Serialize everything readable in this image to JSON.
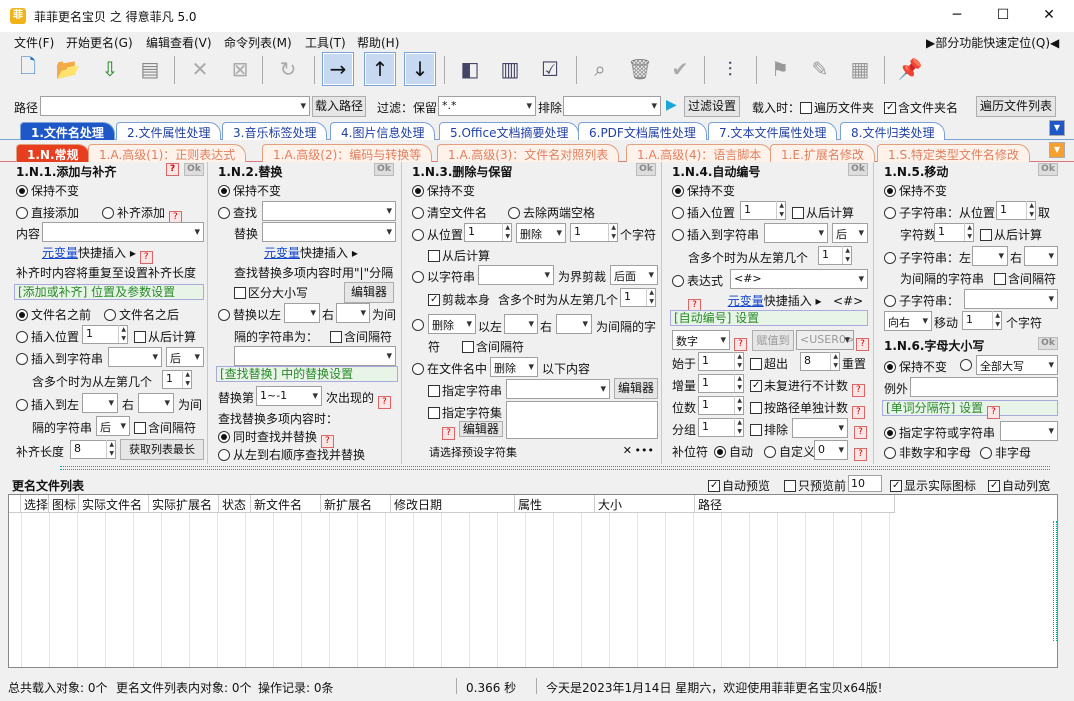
{
  "window": {
    "title": "菲菲更名宝贝 之 得意菲凡 5.0",
    "app_icon": "菲",
    "minimize": "─",
    "maximize": "☐",
    "close": "✕"
  },
  "menu": {
    "items": [
      "文件(F)",
      "开始更名(G)",
      "编辑查看(V)",
      "命令列表(M)",
      "工具(T)",
      "帮助(H)"
    ],
    "right_link": "▶部分功能快速定位(Q)◀"
  },
  "toolbar": {
    "icons": [
      "new-file-icon",
      "open-folder-icon",
      "import-icon",
      "load-list-icon",
      "delete-icon",
      "remove-icon",
      "refresh-icon",
      "move-right-icon",
      "move-up-icon",
      "move-down-icon",
      "column-left-icon",
      "column-icon",
      "checklist-icon",
      "search-icon",
      "trash-schedule-icon",
      "check-circle-icon",
      "adjust-icon",
      "flag-icon",
      "edit-doc-icon",
      "table-edit-icon",
      "pin-icon"
    ]
  },
  "pathbar": {
    "path_label": "路径",
    "path_value": "",
    "load_path": "载入路径",
    "filter_label": "过滤：保留",
    "filter_value": "*.*",
    "exclude_label": "排除",
    "exclude_value": "",
    "filter_settings": "过滤设置",
    "load_when": "载入时：",
    "traverse_files": "遍历文件夹",
    "include_folder": "含文件夹名",
    "traverse_list": "遍历文件列表"
  },
  "tabs_main": [
    "1.文件名处理",
    "2.文件属性处理",
    "3.音乐标签处理",
    "4.图片信息处理",
    "5.Office文档摘要处理",
    "6.PDF文档属性处理",
    "7.文本文件属性处理",
    "8.文件归类处理"
  ],
  "tabs_sub": [
    "1.N.常规",
    "1.A.高级(1)：正则表达式",
    "1.A.高级(2)：编码与转换等",
    "1.A.高级(3)：文件名对照列表",
    "1.A.高级(4)：语言脚本",
    "1.E.扩展名修改",
    "1.S.特定类型文件名修改"
  ],
  "p1": {
    "title": "1.N.1.添加与补齐",
    "q": "?",
    "ok": "Ok",
    "keep": "保持不变",
    "direct_add": "直接添加",
    "pad_add": "补齐添加",
    "content_label": "内容",
    "meta_link": "元变量",
    "quick_insert": "快捷插入 ▸",
    "pad_note": "补齐时内容将重复至设置补齐长度",
    "section": "[添加或补齐] 位置及参数设置",
    "before_name": "文件名之前",
    "after_name": "文件名之后",
    "insert_pos": "插入位置",
    "pos_value": "1",
    "from_back": "从后计算",
    "insert_to_str": "插入到字符串",
    "after": "后",
    "contains_multi": "含多个时为从左第几个",
    "nth_value": "1",
    "insert_between": "插入到左",
    "right": "右",
    "between": "为间",
    "sep_str": "隔的字符串",
    "after2": "后",
    "include_sep": "含间隔符",
    "pad_len": "补齐长度",
    "pad_value": "8",
    "get_max": "获取列表最长"
  },
  "p2": {
    "title": "1.N.2.替换",
    "q": "?",
    "ok": "Ok",
    "keep": "保持不变",
    "find": "查找",
    "replace": "替换",
    "meta_link": "元变量",
    "quick_insert": "快捷插入 ▸",
    "multi_note": "查找替换多项内容时用\"|\"分隔",
    "case": "区分大小写",
    "editor": "编辑器",
    "replace_between": "替换以左",
    "right": "右",
    "between": "为间",
    "sep_str": "隔的字符串为：",
    "include_sep": "含间隔符",
    "section": "[查找替换] 中的替换设置",
    "replace_nth": "替换第",
    "nth_value": "1~-1",
    "occurrence": "次出现的",
    "multi_find": "查找替换多项内容时：",
    "simultaneous": "同时查找并替换",
    "sequential": "从左到右顺序查找并替换"
  },
  "p3": {
    "title": "1.N.3.删除与保留",
    "ok": "Ok",
    "keep": "保持不变",
    "clear_name": "清空文件名",
    "trim_spaces": "去除两端空格",
    "from_pos": "从位置",
    "pos_value": "1",
    "delete": "删除",
    "count_value": "1",
    "chars": "个字符",
    "from_back": "从后计算",
    "by_string": "以字符串",
    "boundary": "为界剪裁",
    "behind": "后面",
    "crop_self": "剪裁本身",
    "contains_multi": "含多个时为从左第几个",
    "nth_value": "1",
    "del2": "删除",
    "left_of": "以左",
    "right": "右",
    "between": "为间隔的字",
    "symbol": "符",
    "include_sep": "含间隔符",
    "in_name": "在文件名中",
    "del3": "删除",
    "following": "以下内容",
    "specify_str": "指定字符串",
    "editor": "编辑器",
    "specify_set": "指定字符集",
    "editor2": "编辑器",
    "preset_placeholder": "请选择预设字符集",
    "clear_x": "✕",
    "more": "•••"
  },
  "p4": {
    "title": "1.N.4.自动编号",
    "ok": "Ok",
    "keep": "保持不变",
    "insert_pos": "插入位置",
    "pos_value": "1",
    "from_back": "从后计算",
    "insert_to_str": "插入到字符串",
    "after": "后",
    "contains_multi": "含多个时为从左第几个",
    "nth_value": "1",
    "expression": "表达式",
    "expr_value": "<#>",
    "meta_link": "元变量",
    "quick_insert": "快捷插入 ▸",
    "expr_tag": "<#>",
    "section": "[自动编号] 设置",
    "num_type": "数字",
    "assign_to": "赋值到",
    "user0": "<USER0>",
    "start": "始于",
    "start_value": "1",
    "exceed": "超出",
    "exceed_value": "8",
    "reset": "重置",
    "step": "增量",
    "step_value": "1",
    "skip_unchanged": "未复进行不计数",
    "digits": "位数",
    "digits_value": "1",
    "per_path": "按路径单独计数",
    "group": "分组",
    "group_value": "1",
    "exclude": "排除",
    "pad_char": "补位符",
    "auto": "自动",
    "custom": "自定义",
    "custom_value": "0"
  },
  "p5": {
    "title": "1.N.5.移动",
    "ok": "Ok",
    "keep": "保持不变",
    "substring_from": "子字符串：从位置",
    "pos_value": "1",
    "take": "取",
    "char_count": "字符数",
    "count_value": "1",
    "from_back": "从后计算",
    "substring_left": "子字符串：左",
    "right": "右",
    "between_str": "为间隔的字符串",
    "include_sep": "含间隔符",
    "substring": "子字符串：",
    "direction": "向右",
    "move": "移动",
    "move_value": "1",
    "chars": "个字符"
  },
  "p6": {
    "title": "1.N.6.字母大小写",
    "ok": "Ok",
    "keep": "保持不变",
    "all_upper": "全部大写",
    "exception": "例外",
    "section": "[单词分隔符] 设置",
    "specify": "指定字符或字符串",
    "non_alnum": "非数字和字母",
    "non_letter": "非字母"
  },
  "list": {
    "title": "更名文件列表",
    "auto_preview": "自动预览",
    "preview_only": "只预览前",
    "preview_count": "10",
    "show_icons": "显示实际图标",
    "auto_width": "自动列宽",
    "columns": [
      "选择",
      "图标",
      "实际文件名",
      "实际扩展名",
      "状态",
      "新文件名",
      "新扩展名",
      "修改日期",
      "属性",
      "大小",
      "路径"
    ]
  },
  "status": {
    "total": "总共载入对象: 0个",
    "in_list": "更名文件列表内对象: 0个",
    "ops": "操作记录: 0条",
    "time": "0.366 秒",
    "today": "今天是2023年1月14日 星期六，欢迎使用菲菲更名宝贝x64版!"
  }
}
